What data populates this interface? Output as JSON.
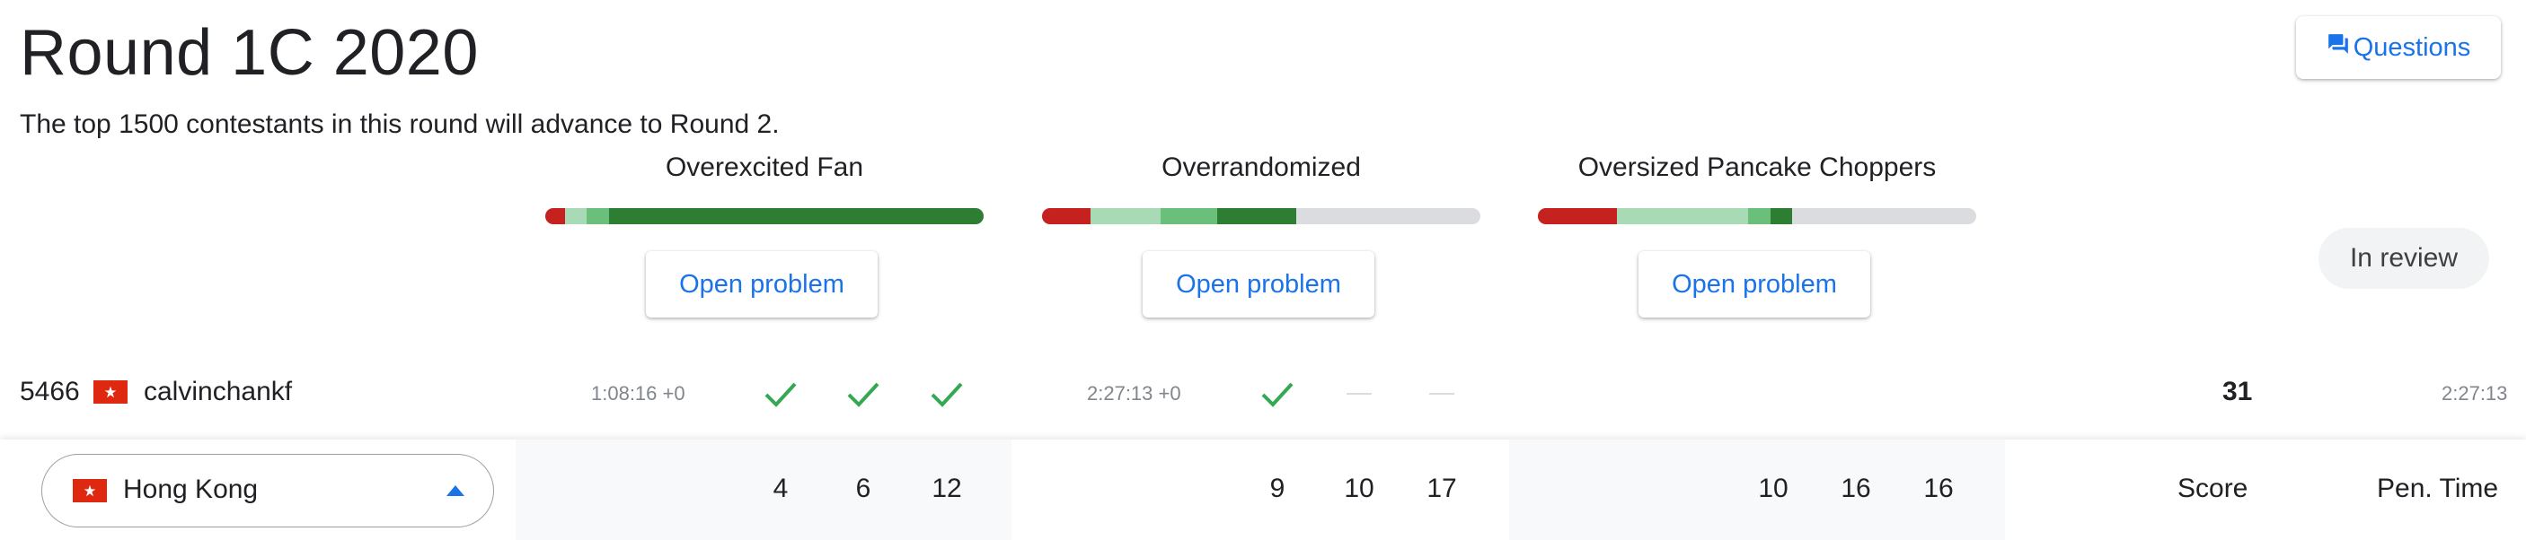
{
  "header": {
    "title": "Round 1C 2020",
    "subtitle": "The top 1500 contestants in this round will advance to Round 2.",
    "questions_label": "Questions",
    "status_label": "In review"
  },
  "problems": [
    {
      "name": "Overexcited Fan",
      "open_label": "Open problem",
      "progress": [
        {
          "color": "#c5221f",
          "fraction": 0.045
        },
        {
          "color": "#a8dab5",
          "fraction": 0.05
        },
        {
          "color": "#6abf7b",
          "fraction": 0.05
        },
        {
          "color": "#2d7d32",
          "fraction": 0.855
        }
      ]
    },
    {
      "name": "Overrandomized",
      "open_label": "Open problem",
      "progress": [
        {
          "color": "#c5221f",
          "fraction": 0.11
        },
        {
          "color": "#a8dab5",
          "fraction": 0.16
        },
        {
          "color": "#6abf7b",
          "fraction": 0.13
        },
        {
          "color": "#2d7d32",
          "fraction": 0.18
        }
      ]
    },
    {
      "name": "Oversized Pancake Choppers",
      "open_label": "Open problem",
      "progress": [
        {
          "color": "#c5221f",
          "fraction": 0.18
        },
        {
          "color": "#a8dab5",
          "fraction": 0.3
        },
        {
          "color": "#6abf7b",
          "fraction": 0.05
        },
        {
          "color": "#2d7d32",
          "fraction": 0.05
        }
      ]
    }
  ],
  "contestant": {
    "rank": "5466",
    "flag": "hong-kong-flag",
    "username": "calvinchankf",
    "problem_results": [
      {
        "time": "1:08:16 +0",
        "tests": [
          "solved",
          "solved",
          "solved"
        ]
      },
      {
        "time": "2:27:13 +0",
        "tests": [
          "solved",
          "none",
          "none"
        ]
      },
      {
        "time": "",
        "tests": []
      }
    ],
    "score": "31",
    "penalty_time": "2:27:13"
  },
  "footer": {
    "country": "Hong Kong",
    "points": [
      [
        "4",
        "6",
        "12"
      ],
      [
        "9",
        "10",
        "17"
      ],
      [
        "10",
        "16",
        "16"
      ]
    ],
    "score_label": "Score",
    "pen_time_label": "Pen. Time"
  },
  "colors": {
    "accent": "#1a73e8",
    "solved_check": "#34a853",
    "flag_red": "#de2910"
  }
}
